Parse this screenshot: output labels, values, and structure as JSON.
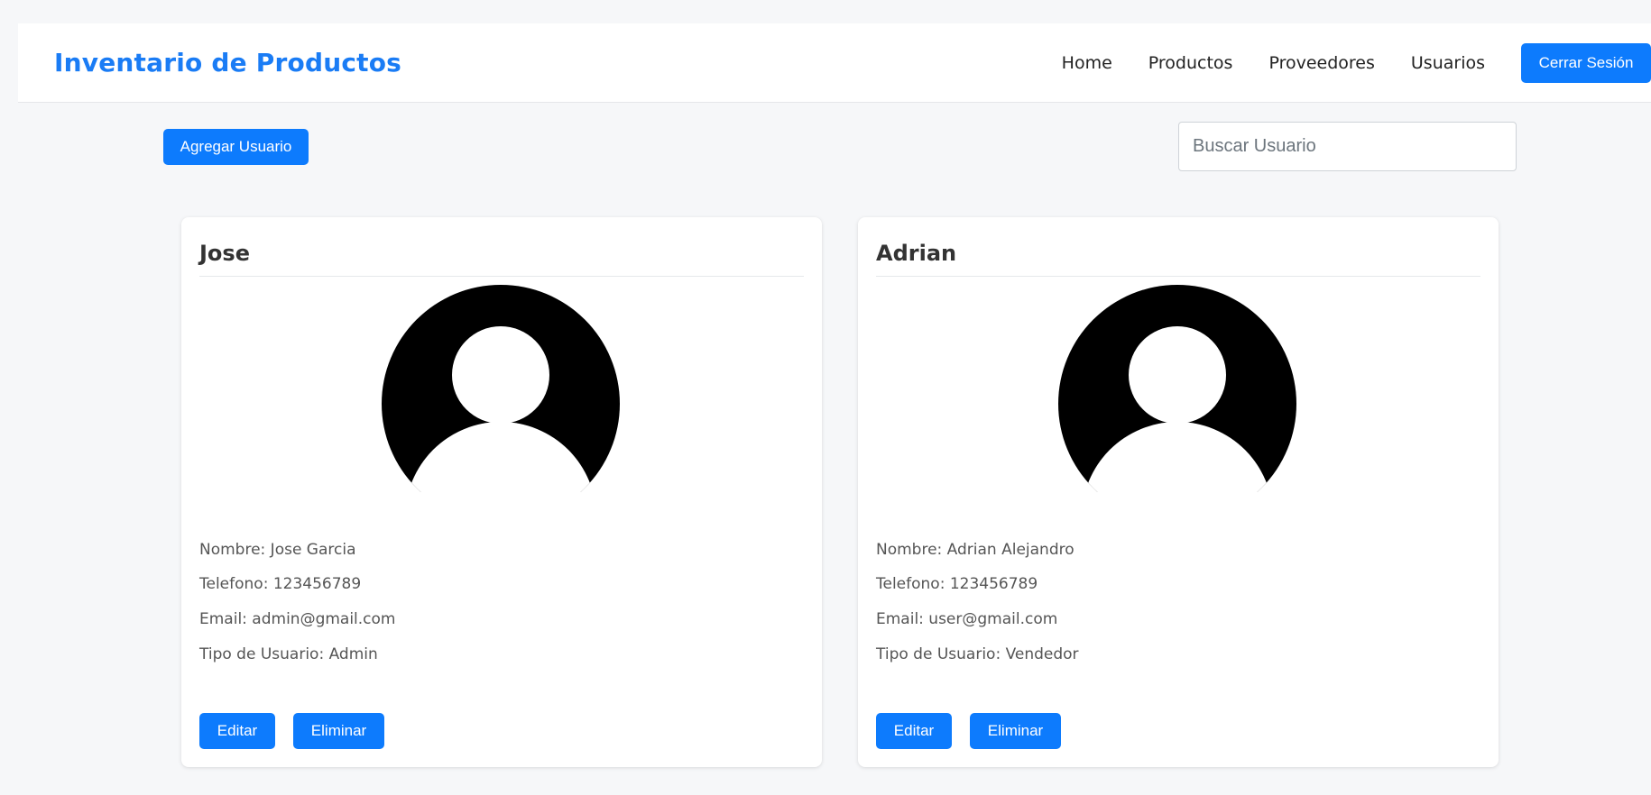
{
  "header": {
    "brand": "Inventario de Productos",
    "nav": [
      "Home",
      "Productos",
      "Proveedores",
      "Usuarios"
    ],
    "logout_label": "Cerrar Sesión"
  },
  "toolbar": {
    "add_label": "Agregar Usuario",
    "search_placeholder": "Buscar Usuario",
    "search_value": ""
  },
  "users": [
    {
      "title": "Jose",
      "nombre": "Nombre: Jose Garcia",
      "telefono": "Telefono: 123456789",
      "email": "Email: admin@gmail.com",
      "tipo": "Tipo de Usuario: Admin",
      "edit_label": "Editar",
      "delete_label": "Eliminar"
    },
    {
      "title": "Adrian",
      "nombre": "Nombre: Adrian Alejandro",
      "telefono": "Telefono: 123456789",
      "email": "Email: user@gmail.com",
      "tipo": "Tipo de Usuario: Vendedor",
      "edit_label": "Editar",
      "delete_label": "Eliminar"
    }
  ],
  "colors": {
    "accent": "#0d7bfd",
    "brand": "#1a7cf5",
    "background": "#f6f7f9"
  },
  "icons": [
    "user-avatar-icon"
  ]
}
